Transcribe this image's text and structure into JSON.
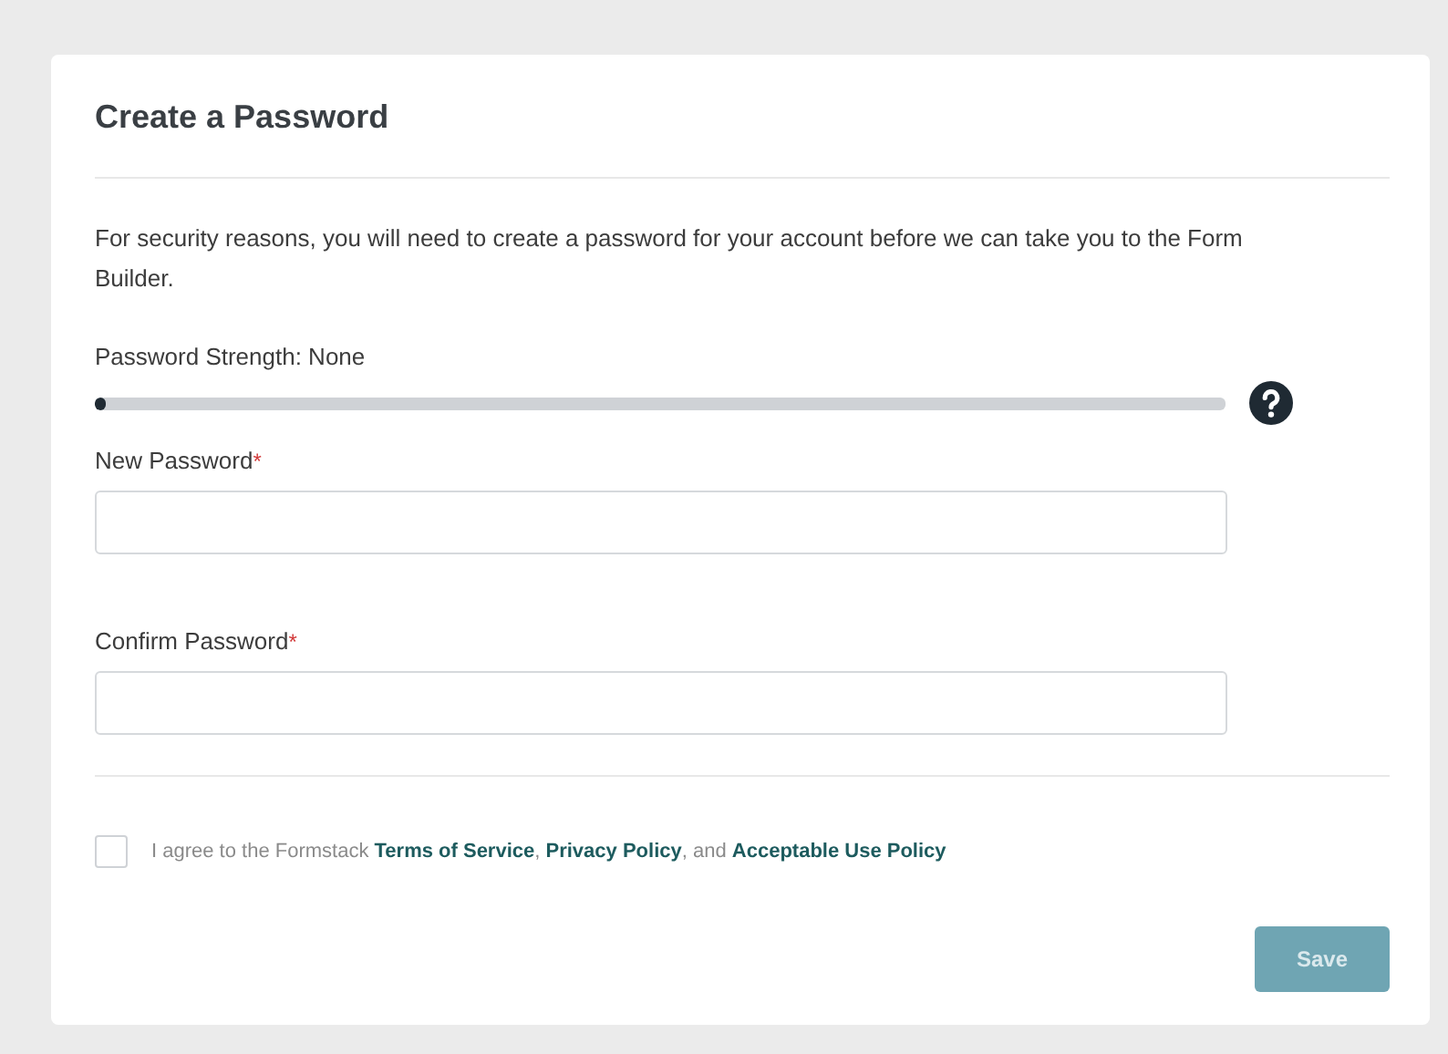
{
  "title": "Create a Password",
  "intro": "For security reasons, you will need to create a password for your account before we can take you to the Form Builder.",
  "strength": {
    "label": "Password Strength: None",
    "level": 0.01
  },
  "fields": [
    {
      "label": "New Password",
      "required_mark": "*"
    },
    {
      "label": "Confirm Password",
      "required_mark": "*"
    }
  ],
  "agreement": {
    "checked": false,
    "lead": "I agree to the Formstack",
    "links": [
      {
        "text": "Terms of Service",
        "after": ","
      },
      {
        "text": "Privacy Policy",
        "after": ", and"
      },
      {
        "text": "Acceptable Use Policy"
      }
    ]
  },
  "save": {
    "label": "Save",
    "disabled": true
  }
}
